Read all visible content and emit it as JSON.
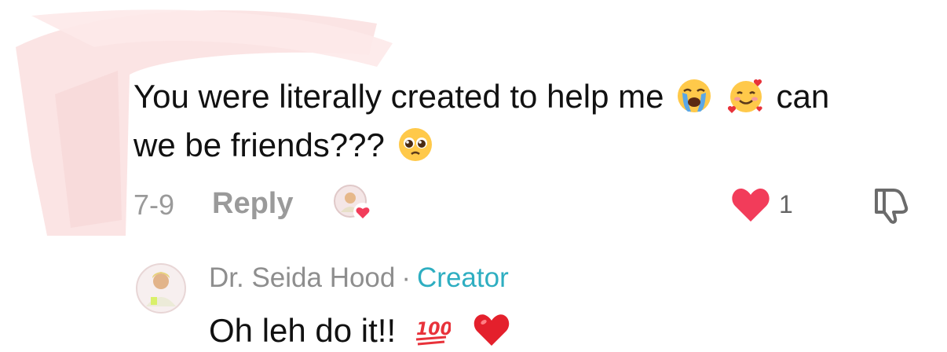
{
  "comment": {
    "text_part1": "You were literally created to help me",
    "text_part2": "can",
    "text_part3": "we be friends???",
    "date": "7-9",
    "reply_label": "Reply",
    "like_count": "1"
  },
  "reply": {
    "author": "Dr. Seida Hood",
    "separator": "·",
    "badge": "Creator",
    "text": "Oh leh do it!!"
  },
  "icons": {
    "emoji_1": "loudly-crying-face",
    "emoji_2": "smiling-face-with-hearts",
    "emoji_3": "pleading-face",
    "emoji_4": "hundred-points",
    "emoji_5": "red-heart",
    "like": "heart-icon",
    "dislike": "thumbs-down-icon"
  },
  "colors": {
    "like_red": "#f23c5a",
    "creator_teal": "#2eaec1",
    "muted_gray": "#9a9a9a",
    "redaction_pink": "#fbe3e3"
  }
}
